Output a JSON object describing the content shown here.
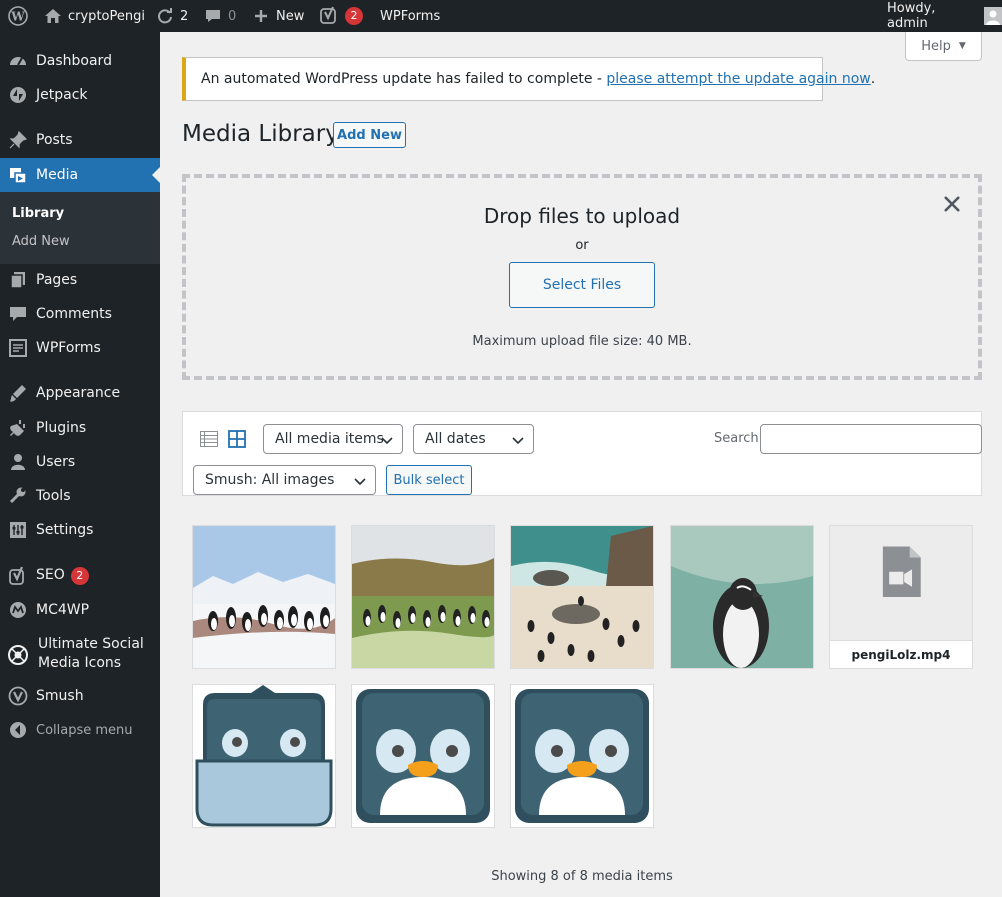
{
  "admin_bar": {
    "site_name": "cryptoPengi",
    "updates_count": "2",
    "comments_count": "0",
    "new_label": "New",
    "yoast_count": "2",
    "wpforms_label": "WPForms",
    "greeting": "Howdy, admin"
  },
  "sidebar": {
    "items": [
      {
        "label": "Dashboard",
        "icon": "dashboard-icon"
      },
      {
        "label": "Jetpack",
        "icon": "jetpack-icon"
      },
      {
        "label": "Posts",
        "icon": "pin-icon"
      },
      {
        "label": "Media",
        "icon": "media-icon"
      },
      {
        "label": "Pages",
        "icon": "pages-icon"
      },
      {
        "label": "Comments",
        "icon": "comments-icon"
      },
      {
        "label": "WPForms",
        "icon": "wpforms-icon"
      },
      {
        "label": "Appearance",
        "icon": "appearance-icon"
      },
      {
        "label": "Plugins",
        "icon": "plugins-icon"
      },
      {
        "label": "Users",
        "icon": "users-icon"
      },
      {
        "label": "Tools",
        "icon": "tools-icon"
      },
      {
        "label": "Settings",
        "icon": "settings-icon"
      },
      {
        "label": "SEO",
        "icon": "yoast-icon",
        "badge": "2"
      },
      {
        "label": "MC4WP",
        "icon": "mc4wp-icon"
      },
      {
        "label": "Ultimate Social Media Icons",
        "icon": "usm-icon"
      },
      {
        "label": "Smush",
        "icon": "smush-icon"
      }
    ],
    "submenu": {
      "library": "Library",
      "add_new": "Add New"
    },
    "collapse": "Collapse menu"
  },
  "help_label": "Help",
  "notice": {
    "text": "An automated WordPress update has failed to complete - ",
    "link": "please attempt the update again now",
    "suffix": "."
  },
  "page": {
    "title": "Media Library",
    "add_new": "Add New"
  },
  "uploader": {
    "title": "Drop files to upload",
    "or": "or",
    "button": "Select Files",
    "max_size": "Maximum upload file size: 40 MB."
  },
  "filters": {
    "media_type": "All media items",
    "dates": "All dates",
    "smush": "Smush: All images",
    "search_label": "Search",
    "search_value": "",
    "bulk_select": "Bulk select"
  },
  "media_items": [
    {
      "kind": "photo",
      "subject": "penguins-on-snow"
    },
    {
      "kind": "photo",
      "subject": "penguins-on-grass"
    },
    {
      "kind": "photo",
      "subject": "penguins-on-beach"
    },
    {
      "kind": "photo",
      "subject": "penguin-by-water"
    },
    {
      "kind": "video",
      "title": "pengiLolz.mp4"
    },
    {
      "kind": "illustration",
      "subject": "penguin-mask-icon"
    },
    {
      "kind": "illustration",
      "subject": "penguin-icon"
    },
    {
      "kind": "illustration",
      "subject": "penguin-icon"
    }
  ],
  "footer": {
    "showing": "Showing 8 of 8 media items"
  },
  "colors": {
    "admin_bg": "#1d2327",
    "accent": "#2271b1",
    "notice_warning": "#dba617",
    "badge": "#d63638"
  }
}
